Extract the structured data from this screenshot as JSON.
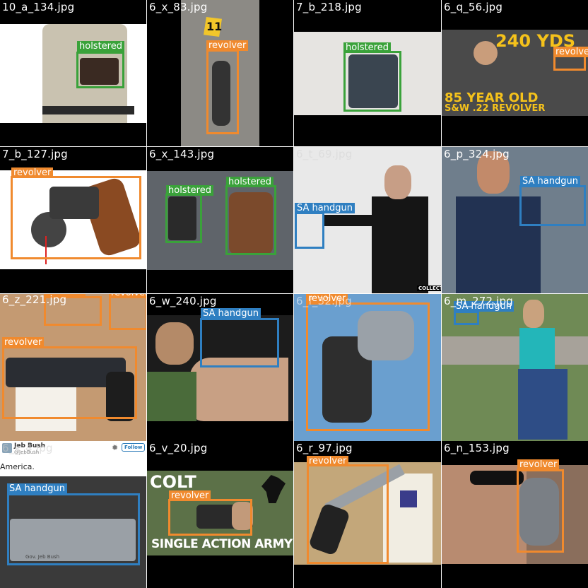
{
  "tiles": [
    {
      "file": "10_a_134.jpg",
      "labels": [
        "holstered"
      ]
    },
    {
      "file": "6_x_83.jpg",
      "labels": [
        "revolver"
      ],
      "marker": "11"
    },
    {
      "file": "7_b_218.jpg",
      "labels": [
        "holstered"
      ]
    },
    {
      "file": "6_q_56.jpg",
      "labels": [
        "revolver"
      ],
      "banner_top": "240 YDS",
      "banner_bottom_1": "85 YEAR OLD",
      "banner_bottom_2": "S&W .22 REVOLVER"
    },
    {
      "file": "7_b_127.jpg",
      "labels": [
        "revolver"
      ]
    },
    {
      "file": "6_x_143.jpg",
      "labels": [
        "holstered",
        "holstered"
      ]
    },
    {
      "file": "6_t_69.jpg",
      "labels": [
        "SA handgun"
      ],
      "watermark": "COLLECTOR"
    },
    {
      "file": "6_p_324.jpg",
      "labels": [
        "SA handgun"
      ]
    },
    {
      "file": "6_z_221.jpg",
      "labels": [
        "revolver",
        "revolver",
        "revolver"
      ]
    },
    {
      "file": "6_w_240.jpg",
      "labels": [
        "SA handgun"
      ]
    },
    {
      "file": "6_f_32.jpg",
      "labels": [
        "revolver"
      ]
    },
    {
      "file": "6_m_272.jpg",
      "labels": [
        "SA handgun"
      ]
    },
    {
      "file": "6_s_4.jpg",
      "labels": [
        "SA handgun"
      ],
      "tweet_name": "Jeb Bush",
      "tweet_handle": "@JebBush",
      "tweet_follow": "Follow",
      "tweet_text": "America.",
      "engraving": "Gov. Jeb Bush"
    },
    {
      "file": "6_v_20.jpg",
      "labels": [
        "revolver"
      ],
      "title_top": "COLT",
      "title_bottom": "SINGLE ACTION ARMY"
    },
    {
      "file": "6_r_97.jpg",
      "labels": [
        "revolver"
      ]
    },
    {
      "file": "6_n_153.jpg",
      "labels": [
        "revolver"
      ]
    }
  ],
  "colors": {
    "revolver": "#f08a2e",
    "holstered": "#3aa23a",
    "sa_handgun": "#2f7fc1"
  }
}
